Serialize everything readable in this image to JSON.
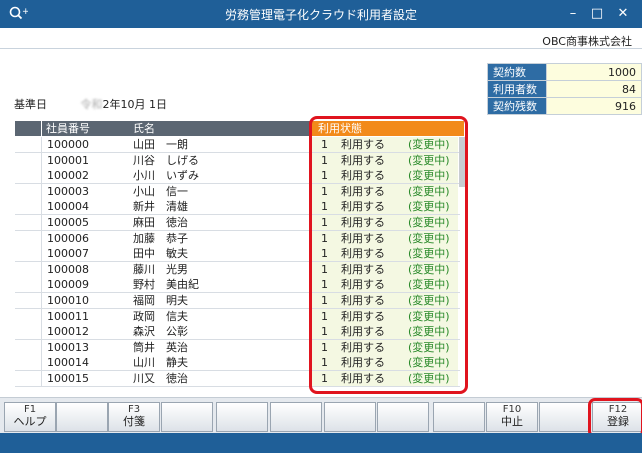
{
  "window": {
    "title": "労務管理電子化クラウド利用者設定",
    "icon": "user-search-icon",
    "min": "–",
    "max": "□",
    "close": "✕"
  },
  "company": "OBC商事株式会社",
  "contract": [
    {
      "label": "契約数",
      "value": "1000"
    },
    {
      "label": "利用者数",
      "value": "84"
    },
    {
      "label": "契約残数",
      "value": "916"
    }
  ],
  "base_date": {
    "label": "基準日",
    "era": "令和",
    "date": "2年10月 1日"
  },
  "table": {
    "headers": {
      "num": "社員番号",
      "name": "氏名",
      "status": "利用状態"
    },
    "rows": [
      {
        "num": "100000",
        "name": "山田　一朗",
        "code": "1",
        "use": "利用する",
        "change": "(変更中)"
      },
      {
        "num": "100001",
        "name": "川谷　しげる",
        "code": "1",
        "use": "利用する",
        "change": "(変更中)"
      },
      {
        "num": "100002",
        "name": "小川　いずみ",
        "code": "1",
        "use": "利用する",
        "change": "(変更中)"
      },
      {
        "num": "100003",
        "name": "小山　信一",
        "code": "1",
        "use": "利用する",
        "change": "(変更中)"
      },
      {
        "num": "100004",
        "name": "新井　清雄",
        "code": "1",
        "use": "利用する",
        "change": "(変更中)"
      },
      {
        "num": "100005",
        "name": "麻田　徳治",
        "code": "1",
        "use": "利用する",
        "change": "(変更中)"
      },
      {
        "num": "100006",
        "name": "加藤　恭子",
        "code": "1",
        "use": "利用する",
        "change": "(変更中)"
      },
      {
        "num": "100007",
        "name": "田中　敏夫",
        "code": "1",
        "use": "利用する",
        "change": "(変更中)"
      },
      {
        "num": "100008",
        "name": "藤川　光男",
        "code": "1",
        "use": "利用する",
        "change": "(変更中)"
      },
      {
        "num": "100009",
        "name": "野村　美由紀",
        "code": "1",
        "use": "利用する",
        "change": "(変更中)"
      },
      {
        "num": "100010",
        "name": "福岡　明夫",
        "code": "1",
        "use": "利用する",
        "change": "(変更中)"
      },
      {
        "num": "100011",
        "name": "政岡　信夫",
        "code": "1",
        "use": "利用する",
        "change": "(変更中)"
      },
      {
        "num": "100012",
        "name": "森沢　公彰",
        "code": "1",
        "use": "利用する",
        "change": "(変更中)"
      },
      {
        "num": "100013",
        "name": "筒井　英治",
        "code": "1",
        "use": "利用する",
        "change": "(変更中)"
      },
      {
        "num": "100014",
        "name": "山川　静夫",
        "code": "1",
        "use": "利用する",
        "change": "(変更中)"
      },
      {
        "num": "100015",
        "name": "川又　徳治",
        "code": "1",
        "use": "利用する",
        "change": "(変更中)"
      }
    ]
  },
  "fkeys": [
    {
      "key": "F1",
      "label": "ヘルプ"
    },
    {
      "key": "",
      "label": ""
    },
    {
      "key": "F3",
      "label": "付箋"
    },
    {
      "key": "",
      "label": ""
    },
    {
      "key": "",
      "label": ""
    },
    {
      "key": "",
      "label": ""
    },
    {
      "key": "",
      "label": ""
    },
    {
      "key": "",
      "label": ""
    },
    {
      "key": "",
      "label": ""
    },
    {
      "key": "F10",
      "label": "中止"
    },
    {
      "key": "",
      "label": ""
    },
    {
      "key": "F12",
      "label": "登録"
    }
  ],
  "colors": {
    "titlebar": "#1f5f98",
    "status_header": "#f28a1a",
    "highlight": "#e0141e",
    "change_text": "#2a8a2a"
  }
}
